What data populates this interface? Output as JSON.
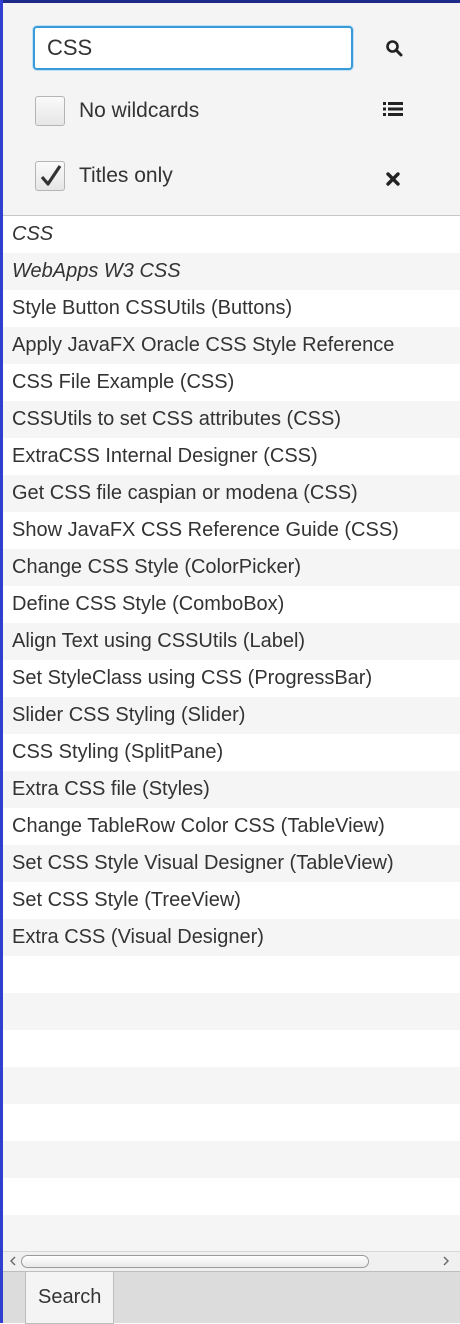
{
  "search": {
    "value": "CSS"
  },
  "options": {
    "no_wildcards_label": "No wildcards",
    "no_wildcards_checked": false,
    "titles_only_label": "Titles only",
    "titles_only_checked": true
  },
  "icons": {
    "search": "search-icon",
    "list": "list-icon",
    "clear": "close-icon"
  },
  "results": [
    {
      "label": "CSS",
      "italic": true
    },
    {
      "label": "WebApps W3 CSS",
      "italic": true
    },
    {
      "label": "Style Button CSSUtils (Buttons)",
      "italic": false
    },
    {
      "label": "Apply JavaFX Oracle CSS Style Reference",
      "italic": false
    },
    {
      "label": "CSS File Example (CSS)",
      "italic": false
    },
    {
      "label": "CSSUtils to set CSS attributes (CSS)",
      "italic": false
    },
    {
      "label": "ExtraCSS Internal Designer (CSS)",
      "italic": false
    },
    {
      "label": "Get CSS file caspian or modena (CSS)",
      "italic": false
    },
    {
      "label": "Show JavaFX CSS Reference Guide (CSS)",
      "italic": false
    },
    {
      "label": "Change CSS Style (ColorPicker)",
      "italic": false
    },
    {
      "label": "Define CSS Style (ComboBox)",
      "italic": false
    },
    {
      "label": "Align Text using CSSUtils (Label)",
      "italic": false
    },
    {
      "label": "Set StyleClass using CSS (ProgressBar)",
      "italic": false
    },
    {
      "label": "Slider CSS Styling (Slider)",
      "italic": false
    },
    {
      "label": "CSS Styling (SplitPane)",
      "italic": false
    },
    {
      "label": "Extra CSS file (Styles)",
      "italic": false
    },
    {
      "label": "Change TableRow Color CSS (TableView)",
      "italic": false
    },
    {
      "label": "Set CSS Style Visual Designer (TableView)",
      "italic": false
    },
    {
      "label": "Set CSS Style (TreeView)",
      "italic": false
    },
    {
      "label": "Extra CSS (Visual Designer)",
      "italic": false
    }
  ],
  "tabs": [
    {
      "label": "Search",
      "selected": true
    }
  ],
  "colors": {
    "focus_border": "#3a9bd9",
    "window_accent": "#2f3fcf"
  }
}
